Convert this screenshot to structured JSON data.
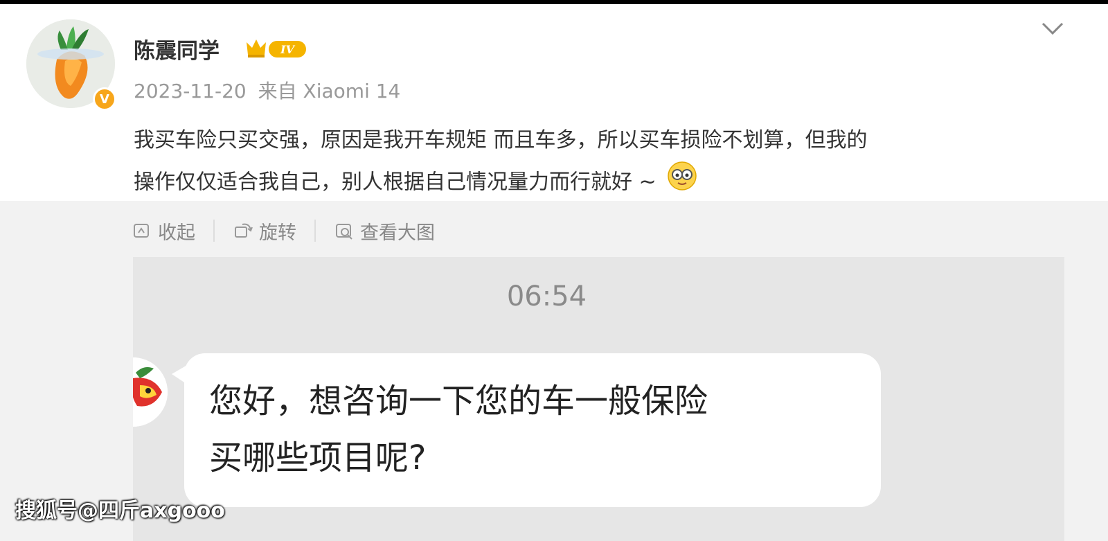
{
  "post": {
    "author": "陈震同学",
    "vip_level": "IV",
    "date": "2023-11-20",
    "source": "来自 Xiaomi 14",
    "text_line1": "我买车险只买交强，原因是我开车规矩 而且车多，所以买车损险不划算，但我的",
    "text_line2": "操作仅仅适合我自己，别人根据自己情况量力而行就好 ~"
  },
  "toolbar": {
    "collapse_label": "收起",
    "rotate_label": "旋转",
    "view_large_label": "查看大图"
  },
  "chat_image": {
    "time": "06:54",
    "message_line1": "您好，想咨询一下您的车一般保险",
    "message_line2": "买哪些项目呢?"
  },
  "watermark": "搜狐号@四斤axgooo",
  "colors": {
    "verified_badge": "#f7a61b",
    "muted_text": "#999999",
    "panel_bg": "#e6e6e6"
  },
  "icons": [
    "chevron-down-icon",
    "vip-crown-icon",
    "verified-icon",
    "collapse-icon",
    "rotate-icon",
    "view-large-icon",
    "emoji-face-icon"
  ]
}
